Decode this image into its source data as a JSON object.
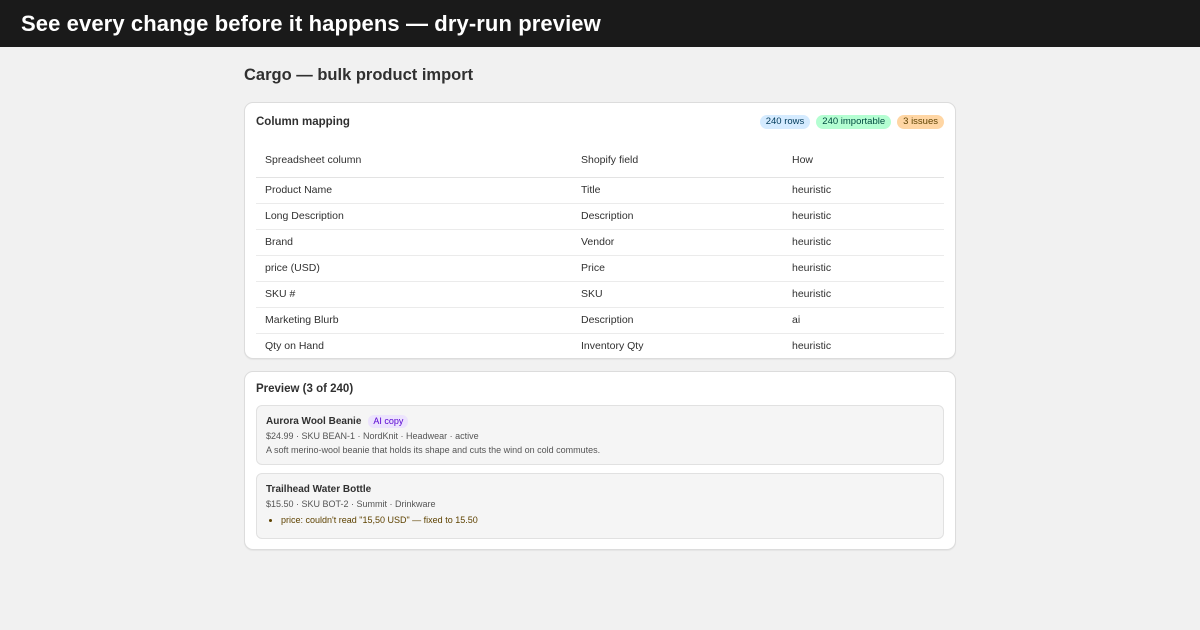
{
  "banner": {
    "title": "See every change before it happens — dry-run preview"
  },
  "page": {
    "title": "Cargo — bulk product import"
  },
  "mapping": {
    "title": "Column mapping",
    "badges": {
      "rows": "240 rows",
      "importable": "240 importable",
      "issues": "3 issues"
    },
    "headers": [
      "Spreadsheet column",
      "Shopify field",
      "How"
    ],
    "rows": [
      [
        "Product Name",
        "Title",
        "heuristic"
      ],
      [
        "Long Description",
        "Description",
        "heuristic"
      ],
      [
        "Brand",
        "Vendor",
        "heuristic"
      ],
      [
        "price (USD)",
        "Price",
        "heuristic"
      ],
      [
        "SKU #",
        "SKU",
        "heuristic"
      ],
      [
        "Marketing Blurb",
        "Description",
        "ai"
      ],
      [
        "Qty on Hand",
        "Inventory Qty",
        "heuristic"
      ]
    ]
  },
  "preview": {
    "title": "Preview (3 of 240)",
    "products": [
      {
        "name": "Aurora Wool Beanie",
        "badge": "AI copy",
        "meta": "$24.99 · SKU BEAN-1 · NordKnit · Headwear · active",
        "description": "A soft merino-wool beanie that holds its shape and cuts the wind on cold commutes."
      },
      {
        "name": "Trailhead Water Bottle",
        "meta": "$15.50 · SKU BOT-2 · Summit · Drinkware",
        "issues": [
          "price: couldn't read \"15,50 USD\" — fixed to 15.50"
        ]
      }
    ]
  },
  "colors": {
    "banner_bg": "#1a1a1a",
    "page_bg": "#f1f1f1",
    "badge_info": "#d5ebff",
    "badge_success": "#b4fed2",
    "badge_warning": "#ffd6a4",
    "badge_ai": "#ece3fd"
  }
}
